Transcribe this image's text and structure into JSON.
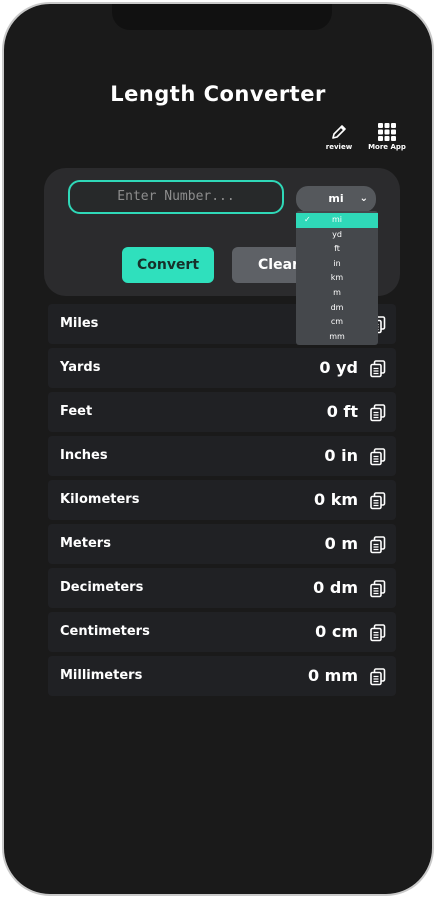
{
  "app": {
    "title": "Length Converter"
  },
  "toolbar": {
    "review_label": "review",
    "more_label": "More App"
  },
  "input": {
    "placeholder": "Enter Number..."
  },
  "unit_select": {
    "selected": "mi",
    "options": [
      "mi",
      "yd",
      "ft",
      "in",
      "km",
      "m",
      "dm",
      "cm",
      "mm"
    ]
  },
  "buttons": {
    "convert": "Convert",
    "clear": "Clear"
  },
  "results": [
    {
      "name": "Miles",
      "value": ""
    },
    {
      "name": "Yards",
      "value": "0 yd"
    },
    {
      "name": "Feet",
      "value": "0 ft"
    },
    {
      "name": "Inches",
      "value": "0 in"
    },
    {
      "name": "Kilometers",
      "value": "0 km"
    },
    {
      "name": "Meters",
      "value": "0 m"
    },
    {
      "name": "Decimeters",
      "value": "0 dm"
    },
    {
      "name": "Centimeters",
      "value": "0 cm"
    },
    {
      "name": "Millimeters",
      "value": "0 mm"
    }
  ],
  "colors": {
    "accent": "#2fe0bd",
    "background": "#1a1a1a",
    "card": "#2b2b2d"
  }
}
